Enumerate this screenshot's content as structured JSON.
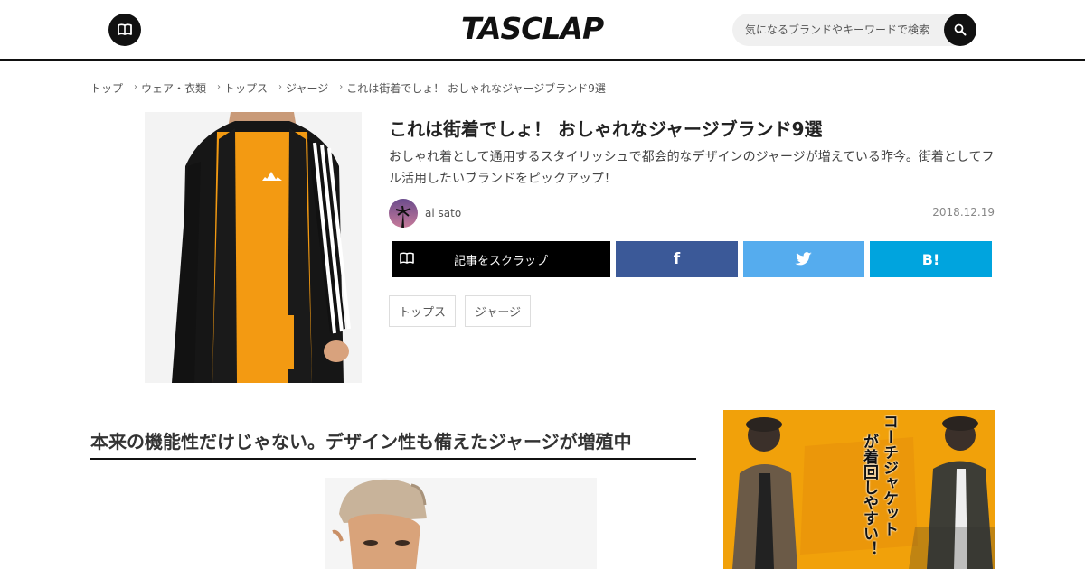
{
  "header": {
    "logo": "TASCLAP",
    "search_placeholder": "気になるブランドやキーワードで検索"
  },
  "breadcrumb": [
    "トップ",
    "ウェア・衣類",
    "トップス",
    "ジャージ",
    "これは街着でしょ！ おしゃれなジャージブランド9選"
  ],
  "article": {
    "title": "これは街着でしょ！ おしゃれなジャージブランド9選",
    "lead": "おしゃれ着として通用するスタイリッシュで都会的なデザインのジャージが増えている昨今。街着としてフル活用したいブランドをピックアップ！",
    "author": "ai sato",
    "date": "2018.12.19",
    "scrap_label": "記事をスクラップ",
    "fb_label": "f",
    "hatena_label": "B!",
    "tags": [
      "トップス",
      "ジャージ"
    ]
  },
  "section": {
    "heading": "本来の機能性だけじゃない。デザイン性も備えたジャージが増殖中"
  },
  "ad": {
    "text_lines": [
      "コーチジャケット",
      "が着回しやすい！"
    ]
  },
  "colors": {
    "facebook": "#3b5998",
    "twitter": "#55acee",
    "hatena": "#00a4de",
    "ad_background": "#f1a10a"
  }
}
